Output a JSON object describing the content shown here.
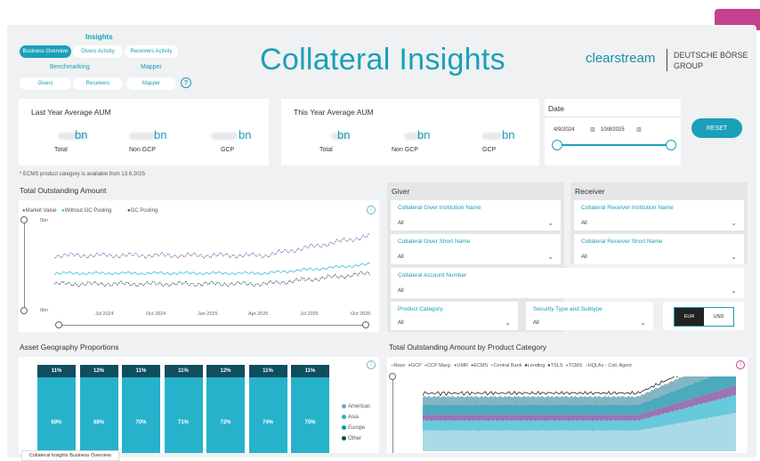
{
  "nav": {
    "title": "Insights",
    "tabs": [
      "Business Overview",
      "Givers Activity",
      "Receivers Activity"
    ],
    "benchmarking_label": "Benchmarking",
    "mapper_label": "Mapper",
    "sub_tabs": [
      "Givers",
      "Receivers",
      "Mapper"
    ],
    "help_glyph": "?"
  },
  "header": {
    "title": "Collateral Insights",
    "brand": "clearstream",
    "brand_group": "DEUTSCHE BÖRSE GROUP"
  },
  "kpi_last": {
    "title": "Last Year Average AUM",
    "units": [
      "bn",
      "bn",
      "bn"
    ],
    "labels": [
      "Total",
      "Non GCP",
      "GCP"
    ]
  },
  "kpi_this": {
    "title": "This Year Average AUM",
    "units": [
      "bn",
      "bn",
      "bn"
    ],
    "labels": [
      "Total",
      "Non GCP",
      "GCP"
    ]
  },
  "date": {
    "label": "Date",
    "start": "4/9/2024",
    "end": "10/8/2025"
  },
  "reset_label": "RESET",
  "note": "* ECMS product category is available from 13.6.2025",
  "outstanding": {
    "title": "Total Outstanding Amount",
    "legend": [
      "Market Value",
      "Without GC Pooling",
      "GC Pooling"
    ],
    "legend_colors": [
      "#8a5ca8",
      "#3cbbd4",
      "#3a4f5c"
    ],
    "y_top": "5bn",
    "y_bottom": "0bn",
    "x_ticks": [
      "Jul 2024",
      "Oct 2024",
      "Jan 2025",
      "Apr 2025",
      "Jul 2025",
      "Oct 2025"
    ]
  },
  "giver": {
    "title": "Giver",
    "fields": [
      {
        "label": "Collateral Giver Institution Name",
        "value": "All"
      },
      {
        "label": "Collateral Giver Short Name",
        "value": "All"
      },
      {
        "label": "Collateral Account Number",
        "value": "All"
      }
    ]
  },
  "receiver": {
    "title": "Receiver",
    "fields": [
      {
        "label": "Collateral Receiver Institution Name",
        "value": "All"
      },
      {
        "label": "Collateral Receiver Short Name",
        "value": "All"
      }
    ]
  },
  "product_category": {
    "label": "Product Category",
    "value": "All"
  },
  "security_type": {
    "label": "Security Type and Subtype",
    "value": "All"
  },
  "currency": {
    "options": [
      "EUR",
      "USD"
    ],
    "selected": "EUR"
  },
  "geography": {
    "title": "Asset Geography Proportions",
    "legend": [
      "Americas",
      "Asia",
      "Europe",
      "Other"
    ],
    "legend_colors": [
      "#6fa8b8",
      "#27b2cc",
      "#1e8fa7",
      "#0f4e5e"
    ],
    "top_labels": [
      "11%",
      "12%",
      "11%",
      "11%",
      "12%",
      "11%",
      "11%"
    ],
    "main_labels": [
      "69%",
      "68%",
      "70%",
      "71%",
      "72%",
      "74%",
      "75%"
    ]
  },
  "product_chart": {
    "title": "Total Outstanding Amount by Product Category",
    "legend": [
      "Repo",
      "GCP",
      "CCP Marg.",
      "UMR",
      "ECMS",
      "Central Bank",
      "Lending",
      "TSLS",
      "TCMS",
      "HQLAx - Coll. Agent"
    ],
    "legend_colors": [
      "#9bd3e0",
      "#2b9bb3",
      "#4cc0d6",
      "#8a5ca8",
      "#1a7d93",
      "#a7b8c0",
      "#222222",
      "#333333",
      "#5fb9c9",
      "#c6dde4"
    ]
  },
  "tooltip": "Collateral Insights Business Overview"
}
